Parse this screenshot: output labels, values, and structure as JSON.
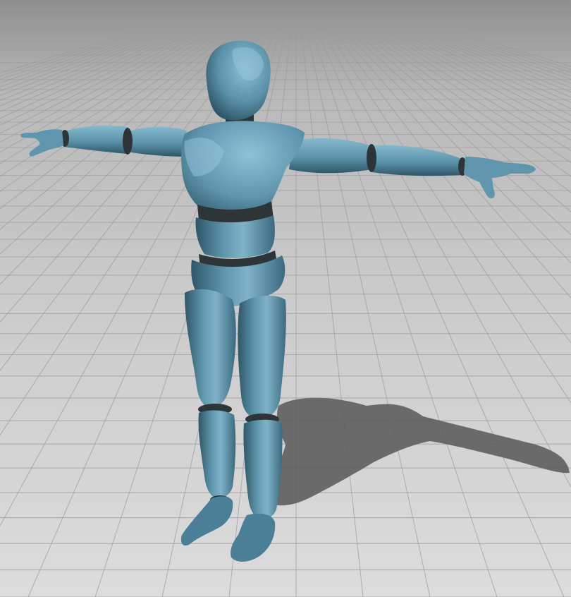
{
  "scene": {
    "subject": "mannequin-t-pose",
    "colors": {
      "sky_top": "#8f8f8f",
      "sky_bottom": "#c9c9c9",
      "floor_far": "#c6c6c6",
      "floor_near": "#dedede",
      "grid_line": "#9a9a9a",
      "shadow": "#5e5e5e",
      "body_base": "#4b7f97",
      "body_light": "#7fb2c8",
      "body_dark": "#2f5668",
      "joint": "#2e3538"
    }
  }
}
